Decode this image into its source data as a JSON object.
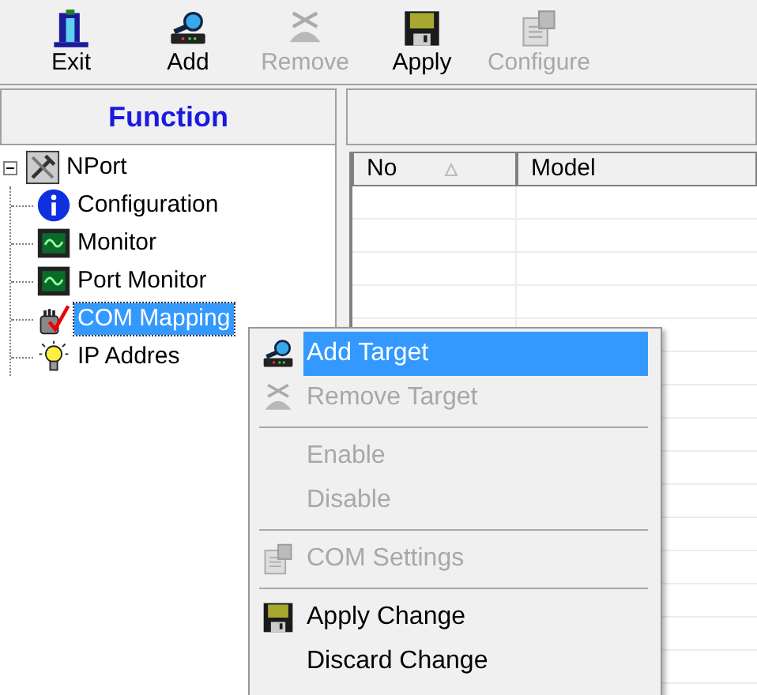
{
  "toolbar": [
    {
      "label": "Exit",
      "kind": "exit",
      "disabled": false
    },
    {
      "label": "Add",
      "kind": "add",
      "disabled": false
    },
    {
      "label": "Remove",
      "kind": "remove",
      "disabled": true
    },
    {
      "label": "Apply",
      "kind": "apply",
      "disabled": false
    },
    {
      "label": "Configure",
      "kind": "configure",
      "disabled": true
    }
  ],
  "function_panel": {
    "title": "Function",
    "tree": [
      {
        "label": "NPort",
        "kind": "tools",
        "expanded": true,
        "selected": false,
        "children": [
          {
            "label": "Configuration",
            "kind": "info",
            "selected": false
          },
          {
            "label": "Monitor",
            "kind": "monitor",
            "selected": false
          },
          {
            "label": "Port Monitor",
            "kind": "monitor",
            "selected": false
          },
          {
            "label": "COM Mapping",
            "kind": "mapping",
            "selected": true
          },
          {
            "label": "IP Addres",
            "kind": "bulb",
            "selected": false
          }
        ]
      }
    ]
  },
  "table": {
    "columns": [
      {
        "label": "No",
        "sorted": true
      },
      {
        "label": "Model",
        "sorted": false
      }
    ]
  },
  "context_menu": [
    {
      "kind": "add",
      "label": "Add Target",
      "disabled": false,
      "selected": true
    },
    {
      "kind": "remove",
      "label": "Remove Target",
      "disabled": true,
      "selected": false
    },
    {
      "kind": "separator"
    },
    {
      "kind": "plain",
      "label": "Enable",
      "disabled": true,
      "selected": false
    },
    {
      "kind": "plain",
      "label": "Disable",
      "disabled": true,
      "selected": false
    },
    {
      "kind": "separator"
    },
    {
      "kind": "configure",
      "label": "COM Settings",
      "disabled": true,
      "selected": false
    },
    {
      "kind": "separator"
    },
    {
      "kind": "apply",
      "label": "Apply Change",
      "disabled": false,
      "selected": false
    },
    {
      "kind": "plain",
      "label": "Discard Change",
      "disabled": false,
      "selected": false
    }
  ]
}
